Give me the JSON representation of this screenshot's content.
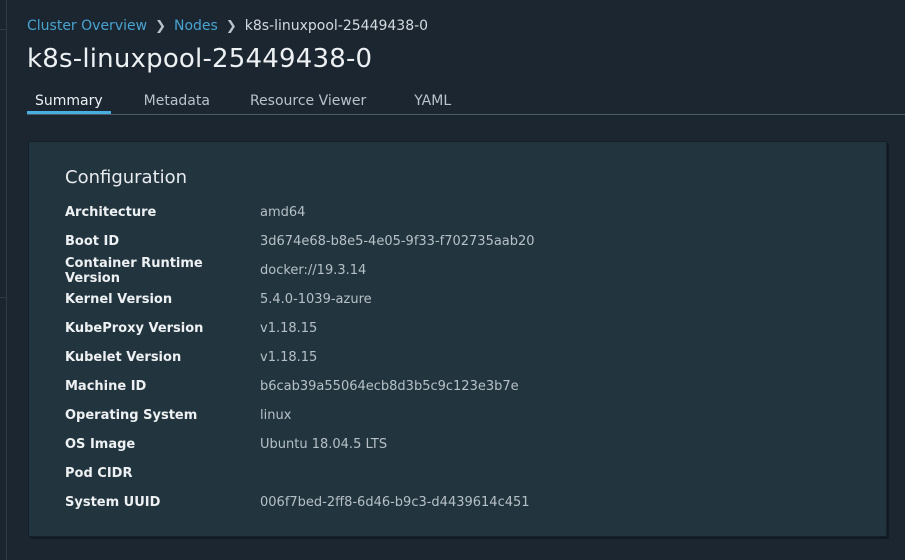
{
  "breadcrumb": [
    {
      "label": "Cluster Overview"
    },
    {
      "label": "Nodes"
    }
  ],
  "breadcrumb_current": "k8s-linuxpool-25449438-0",
  "title": "k8s-linuxpool-25449438-0",
  "tabs": [
    {
      "label": "Summary",
      "active": true
    },
    {
      "label": "Metadata"
    },
    {
      "label": "Resource Viewer"
    },
    {
      "label": "YAML"
    }
  ],
  "configuration": {
    "heading": "Configuration",
    "rows": [
      {
        "key": "Architecture",
        "value": "amd64"
      },
      {
        "key": "Boot ID",
        "value": "3d674e68-b8e5-4e05-9f33-f702735aab20"
      },
      {
        "key": "Container Runtime Version",
        "value": "docker://19.3.14"
      },
      {
        "key": "Kernel Version",
        "value": "5.4.0-1039-azure"
      },
      {
        "key": "KubeProxy Version",
        "value": "v1.18.15"
      },
      {
        "key": "Kubelet Version",
        "value": "v1.18.15"
      },
      {
        "key": "Machine ID",
        "value": "b6cab39a55064ecb8d3b5c9c123e3b7e"
      },
      {
        "key": "Operating System",
        "value": "linux"
      },
      {
        "key": "OS Image",
        "value": "Ubuntu 18.04.5 LTS"
      },
      {
        "key": "Pod CIDR",
        "value": ""
      },
      {
        "key": "System UUID",
        "value": "006f7bed-2ff8-6d46-b9c3-d4439614c451"
      }
    ]
  },
  "colors": {
    "accent": "#49a3d1",
    "background": "#1b2631",
    "card": "#22343e"
  }
}
